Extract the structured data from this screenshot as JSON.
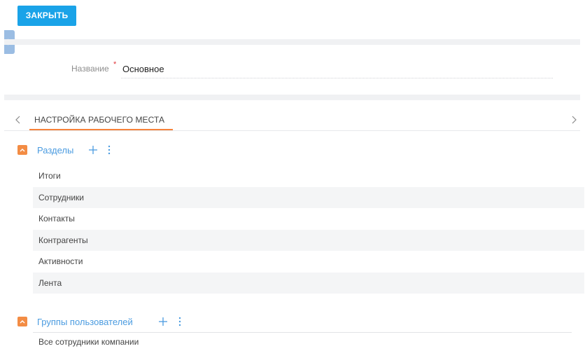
{
  "toolbar": {
    "close_label": "ЗАКРЫТЬ"
  },
  "field": {
    "label": "Название",
    "required_mark": "*",
    "value": "Основное"
  },
  "tabs": [
    {
      "label": "НАСТРОЙКА РАБОЧЕГО МЕСТА",
      "active": true
    }
  ],
  "sections_group": {
    "title": "Разделы",
    "items": [
      "Итоги",
      "Сотрудники",
      "Контакты",
      "Контрагенты",
      "Активности",
      "Лента"
    ]
  },
  "user_groups": {
    "title": "Группы пользователей",
    "items": [
      "Все сотрудники компании"
    ]
  },
  "colors": {
    "primary_button": "#1aa3e8",
    "accent_orange": "#f6823a",
    "link_blue": "#4a9be0",
    "side_handle": "#9bbde3"
  },
  "icons": [
    "chevron-right-icon",
    "chevron-left-icon",
    "chevron-up-icon",
    "plus-icon",
    "more-vertical-icon"
  ]
}
